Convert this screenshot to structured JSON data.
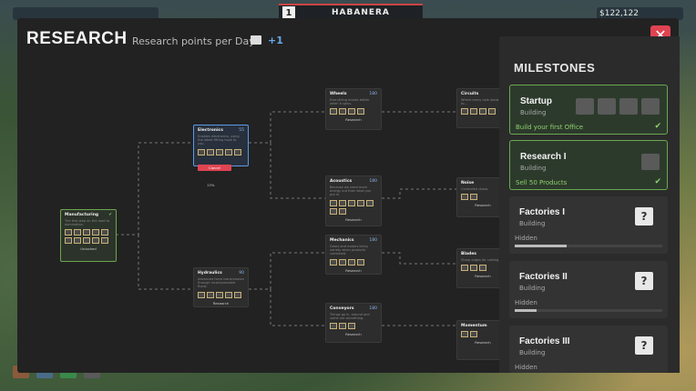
{
  "header": {
    "title": "RESEARCH",
    "points_label": "Research points per Day:",
    "points_value": "+1",
    "city_num": "1",
    "city_name": "HABANERA",
    "money": "$122,122"
  },
  "tree": {
    "nodes": [
      {
        "id": "manufacturing",
        "title": "Manufacturing",
        "cost": "",
        "desc": "The first step on the road to domination.",
        "action": "Unlocked",
        "state": "unlocked"
      },
      {
        "id": "electronics",
        "title": "Electronics",
        "cost": "55",
        "desc": "Enables electronics, using the latest fitting hook to you.",
        "action": "Cancel",
        "progress": "13%",
        "state": "selected"
      },
      {
        "id": "hydraulics",
        "title": "Hydraulics",
        "cost": "90",
        "desc": "Advanced force-transmission through incompressible fluids.",
        "action": "Research",
        "state": "locked"
      },
      {
        "id": "wheels",
        "title": "Wheels",
        "cost": "180",
        "desc": "Everything moves better when it spins.",
        "action": "Research",
        "state": "locked"
      },
      {
        "id": "acoustics",
        "title": "Acoustics",
        "cost": "180",
        "desc": "Because we need more energy out than what you put in.",
        "action": "Research",
        "state": "locked"
      },
      {
        "id": "mechanics",
        "title": "Mechanics",
        "cost": "180",
        "desc": "Gears and motors bring variety when products combined.",
        "action": "Research",
        "state": "locked"
      },
      {
        "id": "conveyors",
        "title": "Conveyors",
        "cost": "180",
        "desc": "Things go in, around and come out something.",
        "action": "Research",
        "state": "locked"
      },
      {
        "id": "circuits",
        "title": "Circuits",
        "cost": "",
        "desc": "Where every hole leads to...",
        "action": "",
        "state": "locked"
      },
      {
        "id": "noise",
        "title": "Noise",
        "cost": "",
        "desc": "Controlled chaos.",
        "action": "Research",
        "state": "locked"
      },
      {
        "id": "blades",
        "title": "Blades",
        "cost": "",
        "desc": "Sharp edges for cutting.",
        "action": "Research",
        "state": "locked"
      },
      {
        "id": "momentum",
        "title": "Momentum",
        "cost": "",
        "desc": "",
        "action": "Research",
        "state": "locked"
      }
    ]
  },
  "milestones": {
    "title": "MILESTONES",
    "items": [
      {
        "name": "Startup",
        "sub": "Building",
        "goal": "Build your first Office",
        "status": "done"
      },
      {
        "name": "Research I",
        "sub": "Building",
        "goal": "Sell 50 Products",
        "status": "done"
      },
      {
        "name": "Factories I",
        "sub": "Building",
        "hidden": "Hidden",
        "progress": 0.35,
        "status": "hidden"
      },
      {
        "name": "Factories II",
        "sub": "Building",
        "hidden": "Hidden",
        "progress": 0.15,
        "status": "hidden"
      },
      {
        "name": "Factories III",
        "sub": "Building",
        "hidden": "Hidden",
        "status": "hidden"
      }
    ]
  },
  "colors": {
    "accent": "#6aa84f",
    "danger": "#e04452",
    "points": "#6aa8e8"
  }
}
